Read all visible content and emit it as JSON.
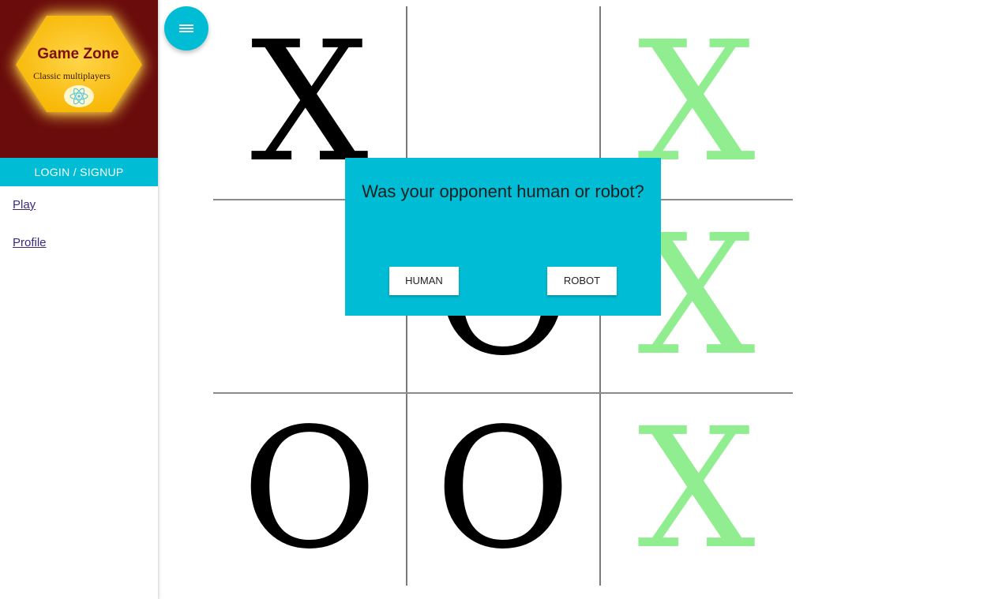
{
  "sidebar": {
    "brand": {
      "title": "Game Zone",
      "subtitle": "Classic multiplayers",
      "logo_icon": "react-atom-icon",
      "background": "#6a0c0c",
      "hex_color": "#ffc90a"
    },
    "login_label": "LOGIN / SIGNUP",
    "nav": [
      {
        "label": "Play"
      },
      {
        "label": "Profile"
      }
    ]
  },
  "menu_button": {
    "icon": "hamburger-menu-icon"
  },
  "board": {
    "cells": [
      {
        "mark": "X",
        "color": "#000000"
      },
      {
        "mark": "",
        "color": "#000000"
      },
      {
        "mark": "X",
        "color": "#90ee90"
      },
      {
        "mark": "",
        "color": "#000000"
      },
      {
        "mark": "O",
        "color": "#000000"
      },
      {
        "mark": "X",
        "color": "#90ee90"
      },
      {
        "mark": "O",
        "color": "#000000"
      },
      {
        "mark": "O",
        "color": "#000000"
      },
      {
        "mark": "X",
        "color": "#90ee90"
      }
    ]
  },
  "dialog": {
    "question": "Was your opponent human or robot?",
    "human_label": "HUMAN",
    "robot_label": "ROBOT"
  },
  "colors": {
    "accent": "#00bcd4",
    "winning_mark": "#90ee90"
  }
}
